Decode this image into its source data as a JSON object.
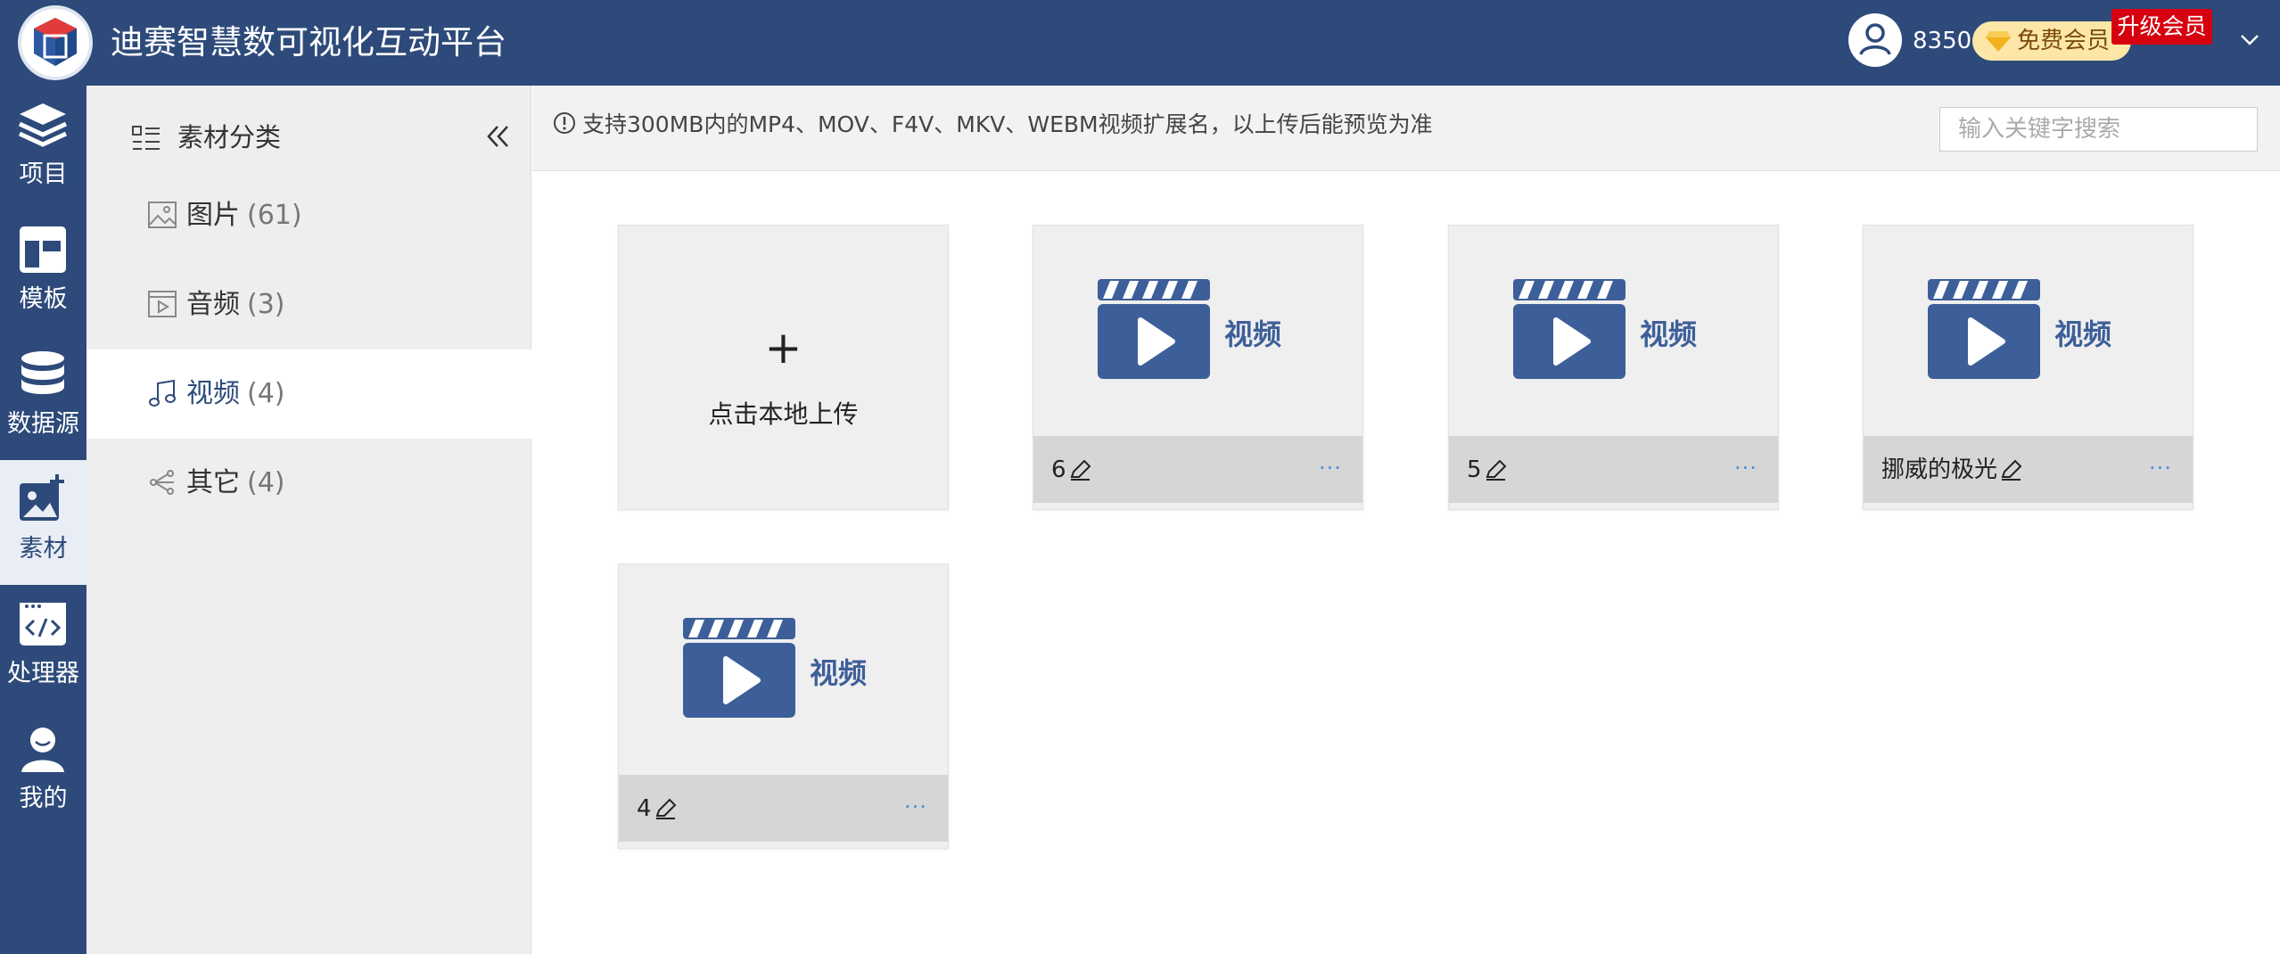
{
  "header": {
    "app_title": "迪赛智慧数可视化互动平台",
    "credits": "8350",
    "member_badge": "免费会员",
    "upgrade_label": "升级会员"
  },
  "nav": {
    "items": [
      {
        "label": "项目",
        "icon": "layers-icon"
      },
      {
        "label": "模板",
        "icon": "template-icon"
      },
      {
        "label": "数据源",
        "icon": "database-icon"
      },
      {
        "label": "素材",
        "icon": "image-add-icon",
        "active": true
      },
      {
        "label": "处理器",
        "icon": "code-icon"
      },
      {
        "label": "我的",
        "icon": "user-icon"
      }
    ]
  },
  "categories": {
    "header": "素材分类",
    "items": [
      {
        "label": "图片",
        "count": "(61)"
      },
      {
        "label": "音频",
        "count": "(3)"
      },
      {
        "label": "视频",
        "count": "(4)",
        "active": true
      },
      {
        "label": "其它",
        "count": "(4)"
      }
    ]
  },
  "infobar": {
    "text": "支持300MB内的MP4、MOV、F4V、MKV、WEBM视频扩展名，以上传后能预览为准",
    "search_placeholder": "输入关键字搜索"
  },
  "upload": {
    "plus": "+",
    "label": "点击本地上传"
  },
  "cards": [
    {
      "name": "6",
      "thumb_label": "视频",
      "more": "···"
    },
    {
      "name": "5",
      "thumb_label": "视频",
      "more": "···"
    },
    {
      "name": "挪威的极光",
      "thumb_label": "视频",
      "more": "···"
    },
    {
      "name": "4",
      "thumb_label": "视频",
      "more": "···"
    }
  ],
  "colors": {
    "primary": "#2d4a7a",
    "thumb_blue": "#3d5f99",
    "upgrade_red": "#d7000f",
    "badge_gold": "#fde7a8",
    "link_blue": "#4a90e2"
  }
}
